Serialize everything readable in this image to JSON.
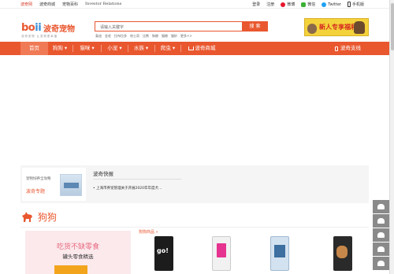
{
  "topbar": {
    "links": [
      "波奇网",
      "波奇商城",
      "宠物百科",
      "Investor Relations"
    ],
    "login": "登录",
    "register": "注册",
    "weibo": "微博",
    "wechat": "微信",
    "twitter": "Twitter",
    "mobile": "手机版"
  },
  "logo": {
    "mark_a": "bo",
    "mark_b": "ii",
    "name": "波奇宠物",
    "slogan": "波奇宠物 让宠物更幸福"
  },
  "search": {
    "placeholder": "请输入关键字",
    "button": "搜 索",
    "hotwords": [
      "泰迪",
      "金毛",
      "拉布拉多",
      "哈士奇",
      "比熊",
      "狗粮",
      "猫粮",
      "猫砂",
      "更多>>"
    ]
  },
  "promo": {
    "text": "新人专享福利"
  },
  "nav": {
    "items": [
      "首页",
      "狗狗",
      "猫咪",
      "小宠",
      "水族",
      "爬虫"
    ],
    "mall": "波奇商城",
    "right": "波奇支线"
  },
  "news": {
    "tile_caption": "宠物饲养全攻略",
    "tile_title": "波奇专题",
    "heading": "波奇快报",
    "item": "• 上海市养宠管理关于开展2020年年度犬..."
  },
  "dog_section": {
    "title": "狗狗",
    "banner_title": "吃货不缺零食",
    "banner_sub": "罐头零食精选",
    "hotsale": "狗狗商品 »"
  },
  "colors": {
    "accent": "#e9572f",
    "nav_active": "#f07a56",
    "banner_bg": "#fbe9ec"
  }
}
